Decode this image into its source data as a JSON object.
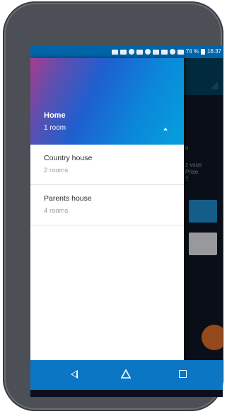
{
  "status_bar": {
    "battery": "74 %",
    "time": "16:37",
    "icons": [
      "message-icon",
      "mail-icon",
      "app-icon",
      "video-icon",
      "app-icon",
      "wrench-icon",
      "nfc-icon",
      "wifi-icon",
      "signal-icon",
      "battery-icon"
    ]
  },
  "background_app": {
    "text_line1": "n",
    "text_line2": "z vous",
    "text_line3": "Prise",
    "text_line4": "?"
  },
  "drawer": {
    "header": {
      "title": "Home",
      "subtitle": "1 room"
    },
    "items": [
      {
        "title": "Country house",
        "subtitle": "2 rooms"
      },
      {
        "title": "Parents house",
        "subtitle": "4 rooms"
      }
    ]
  },
  "nav_bar": {
    "buttons": [
      "back",
      "home",
      "recents"
    ]
  },
  "colors": {
    "status_bar": "#0064a8",
    "nav_bar": "#0b76c3",
    "accent_fab": "#e2702b",
    "accent_button": "#1e8fd1"
  }
}
